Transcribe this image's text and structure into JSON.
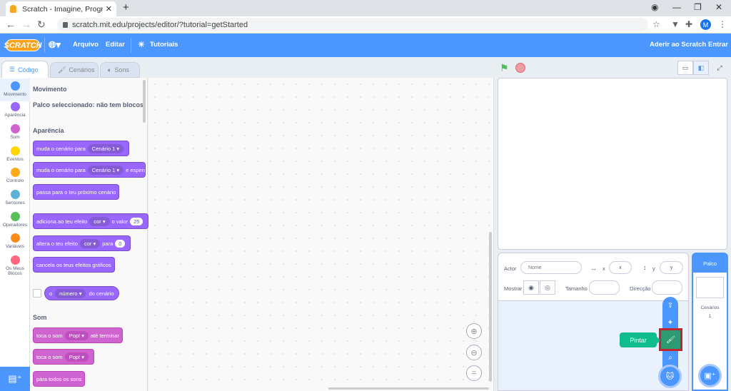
{
  "browser": {
    "tab_title": "Scratch - Imagine, Program, Share",
    "tab_close": "✕",
    "new_tab": "+",
    "url": "scratch.mit.edu/projects/editor/?tutorial=getStarted",
    "profile_initial": "M"
  },
  "menubar": {
    "logo": "SCRATCH",
    "file": "Arquivo",
    "edit": "Editar",
    "tutorials": "Tutoriais",
    "join": "Aderir ao Scratch",
    "signin": "Entrar"
  },
  "tabs": {
    "code": "Código",
    "costumes": "Cenários",
    "sounds": "Sons"
  },
  "categories": [
    {
      "label": "Movimento",
      "color": "#4c97ff"
    },
    {
      "label": "Aparência",
      "color": "#9966ff"
    },
    {
      "label": "Som",
      "color": "#cf63cf"
    },
    {
      "label": "Eventos",
      "color": "#ffd500"
    },
    {
      "label": "Controlo",
      "color": "#ffab19"
    },
    {
      "label": "Sensores",
      "color": "#5cb1d6"
    },
    {
      "label": "Operadores",
      "color": "#59c059"
    },
    {
      "label": "Variáveis",
      "color": "#ff8c1a"
    },
    {
      "label": "Os Meus Blocos",
      "color": "#ff6680"
    }
  ],
  "palette": {
    "motion_title": "Movimento",
    "motion_note": "Palco seleccionado: não tem blocos de movimento",
    "looks_title": "Aparência",
    "block1_text": "muda o cenário para",
    "block1_dd": "Cenário 1",
    "block2_text": "muda o cenário para",
    "block2_dd": "Cenário 1",
    "block2_suffix": "e espera",
    "block3_text": "passa para o teu próximo cenário",
    "block4_text": "adiciona ao teu efeito",
    "block4_dd": "cor",
    "block4_mid": "o valor",
    "block4_num": "25",
    "block5_text": "altera o teu efeito",
    "block5_dd": "cor",
    "block5_mid": "para",
    "block5_num": "0",
    "block6_text": "cancela os teus efeitos gráficos",
    "reporter_pre": "o",
    "reporter_dd": "número",
    "reporter_post": "do cenário",
    "sound_title": "Som",
    "sblock1_text": "toca o som",
    "sblock1_dd": "Pop!",
    "sblock1_suffix": "até terminar",
    "sblock2_text": "toca o som",
    "sblock2_dd": "Pop!",
    "sblock3_text": "pára todos os sons"
  },
  "sprite_info": {
    "sprite_label": "Actor",
    "name_placeholder": "Nome",
    "x_label": "x",
    "x_value": "x",
    "y_label": "y",
    "y_value": "y",
    "show_label": "Mostrar",
    "size_label": "Tamanho",
    "direction_label": "Direcção"
  },
  "chooser": {
    "paint_tooltip": "Pintar"
  },
  "stage_pane": {
    "title": "Palco",
    "backdrops_label": "Cenários",
    "backdrops_count": "1"
  },
  "colors": {
    "menubar": "#4c97ff",
    "highlight": "#c0262d",
    "tooltip": "#0fbd8c"
  }
}
